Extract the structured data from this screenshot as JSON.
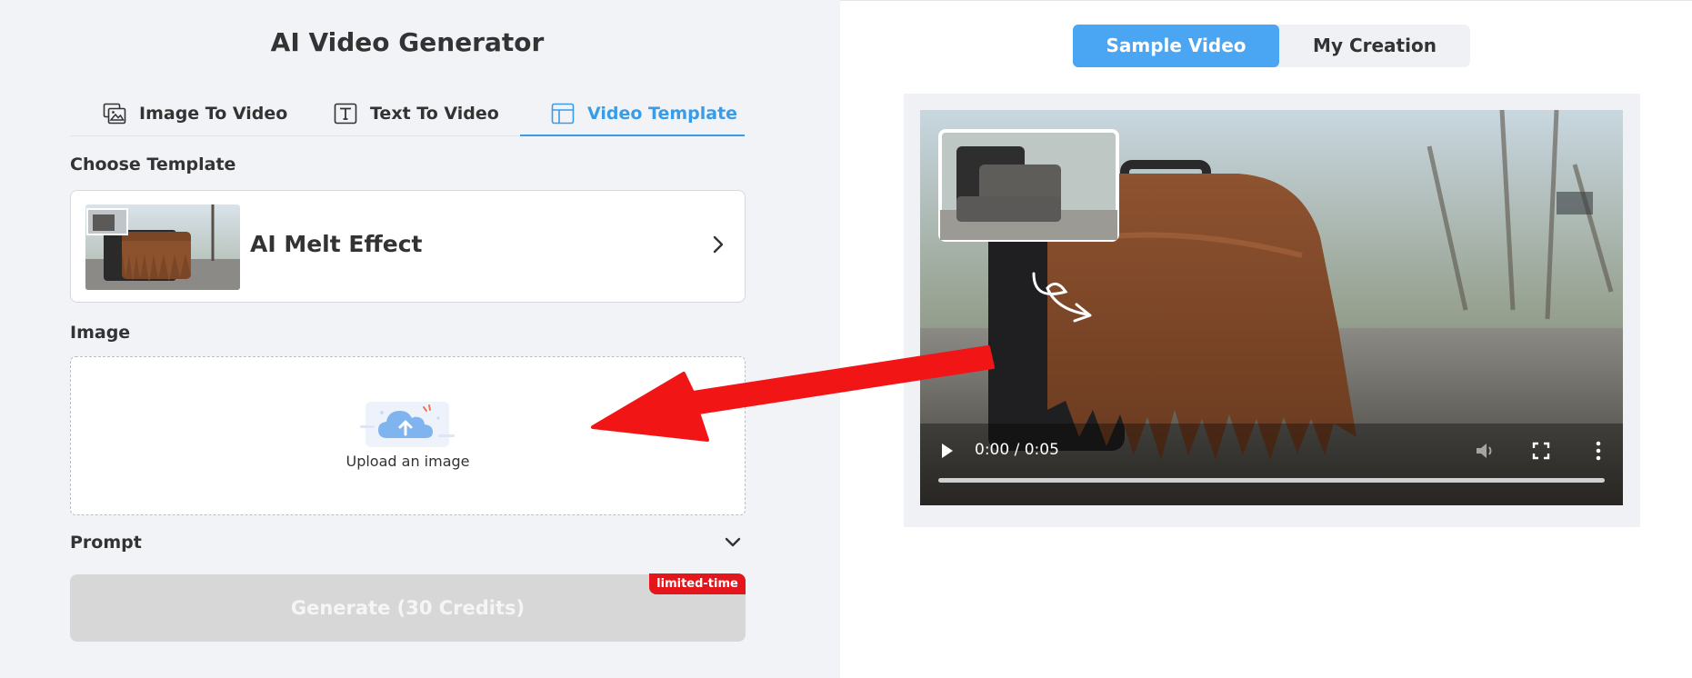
{
  "generator": {
    "title": "AI Video Generator",
    "tabs": [
      {
        "label": "Image To Video",
        "icon": "image-to-video-icon"
      },
      {
        "label": "Text To Video",
        "icon": "text-to-video-icon"
      },
      {
        "label": "Video Template",
        "icon": "video-template-icon",
        "active": true
      }
    ],
    "choose_template_label": "Choose Template",
    "template": {
      "name": "AI Melt Effect"
    },
    "image_label": "Image",
    "upload_text": "Upload an image",
    "prompt_label": "Prompt",
    "generate_label": "Generate (30 Credits)",
    "badge": "limited-time"
  },
  "preview": {
    "segments": [
      "Sample Video",
      "My Creation"
    ],
    "active_segment": "Sample Video",
    "time": "0:00 / 0:05"
  },
  "colors": {
    "accent": "#3a9be6",
    "segment_active": "#4aa6f3",
    "badge": "#e4151b",
    "annotation_arrow": "#f11515"
  }
}
